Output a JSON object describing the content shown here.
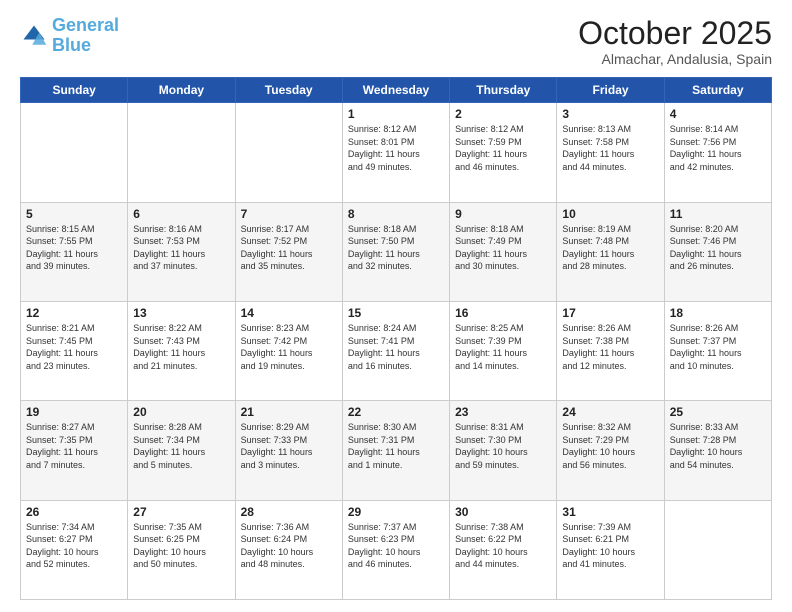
{
  "header": {
    "logo_line1": "General",
    "logo_line2": "Blue",
    "month_title": "October 2025",
    "location": "Almachar, Andalusia, Spain"
  },
  "weekdays": [
    "Sunday",
    "Monday",
    "Tuesday",
    "Wednesday",
    "Thursday",
    "Friday",
    "Saturday"
  ],
  "weeks": [
    [
      {
        "day": "",
        "info": ""
      },
      {
        "day": "",
        "info": ""
      },
      {
        "day": "",
        "info": ""
      },
      {
        "day": "1",
        "info": "Sunrise: 8:12 AM\nSunset: 8:01 PM\nDaylight: 11 hours\nand 49 minutes."
      },
      {
        "day": "2",
        "info": "Sunrise: 8:12 AM\nSunset: 7:59 PM\nDaylight: 11 hours\nand 46 minutes."
      },
      {
        "day": "3",
        "info": "Sunrise: 8:13 AM\nSunset: 7:58 PM\nDaylight: 11 hours\nand 44 minutes."
      },
      {
        "day": "4",
        "info": "Sunrise: 8:14 AM\nSunset: 7:56 PM\nDaylight: 11 hours\nand 42 minutes."
      }
    ],
    [
      {
        "day": "5",
        "info": "Sunrise: 8:15 AM\nSunset: 7:55 PM\nDaylight: 11 hours\nand 39 minutes."
      },
      {
        "day": "6",
        "info": "Sunrise: 8:16 AM\nSunset: 7:53 PM\nDaylight: 11 hours\nand 37 minutes."
      },
      {
        "day": "7",
        "info": "Sunrise: 8:17 AM\nSunset: 7:52 PM\nDaylight: 11 hours\nand 35 minutes."
      },
      {
        "day": "8",
        "info": "Sunrise: 8:18 AM\nSunset: 7:50 PM\nDaylight: 11 hours\nand 32 minutes."
      },
      {
        "day": "9",
        "info": "Sunrise: 8:18 AM\nSunset: 7:49 PM\nDaylight: 11 hours\nand 30 minutes."
      },
      {
        "day": "10",
        "info": "Sunrise: 8:19 AM\nSunset: 7:48 PM\nDaylight: 11 hours\nand 28 minutes."
      },
      {
        "day": "11",
        "info": "Sunrise: 8:20 AM\nSunset: 7:46 PM\nDaylight: 11 hours\nand 26 minutes."
      }
    ],
    [
      {
        "day": "12",
        "info": "Sunrise: 8:21 AM\nSunset: 7:45 PM\nDaylight: 11 hours\nand 23 minutes."
      },
      {
        "day": "13",
        "info": "Sunrise: 8:22 AM\nSunset: 7:43 PM\nDaylight: 11 hours\nand 21 minutes."
      },
      {
        "day": "14",
        "info": "Sunrise: 8:23 AM\nSunset: 7:42 PM\nDaylight: 11 hours\nand 19 minutes."
      },
      {
        "day": "15",
        "info": "Sunrise: 8:24 AM\nSunset: 7:41 PM\nDaylight: 11 hours\nand 16 minutes."
      },
      {
        "day": "16",
        "info": "Sunrise: 8:25 AM\nSunset: 7:39 PM\nDaylight: 11 hours\nand 14 minutes."
      },
      {
        "day": "17",
        "info": "Sunrise: 8:26 AM\nSunset: 7:38 PM\nDaylight: 11 hours\nand 12 minutes."
      },
      {
        "day": "18",
        "info": "Sunrise: 8:26 AM\nSunset: 7:37 PM\nDaylight: 11 hours\nand 10 minutes."
      }
    ],
    [
      {
        "day": "19",
        "info": "Sunrise: 8:27 AM\nSunset: 7:35 PM\nDaylight: 11 hours\nand 7 minutes."
      },
      {
        "day": "20",
        "info": "Sunrise: 8:28 AM\nSunset: 7:34 PM\nDaylight: 11 hours\nand 5 minutes."
      },
      {
        "day": "21",
        "info": "Sunrise: 8:29 AM\nSunset: 7:33 PM\nDaylight: 11 hours\nand 3 minutes."
      },
      {
        "day": "22",
        "info": "Sunrise: 8:30 AM\nSunset: 7:31 PM\nDaylight: 11 hours\nand 1 minute."
      },
      {
        "day": "23",
        "info": "Sunrise: 8:31 AM\nSunset: 7:30 PM\nDaylight: 10 hours\nand 59 minutes."
      },
      {
        "day": "24",
        "info": "Sunrise: 8:32 AM\nSunset: 7:29 PM\nDaylight: 10 hours\nand 56 minutes."
      },
      {
        "day": "25",
        "info": "Sunrise: 8:33 AM\nSunset: 7:28 PM\nDaylight: 10 hours\nand 54 minutes."
      }
    ],
    [
      {
        "day": "26",
        "info": "Sunrise: 7:34 AM\nSunset: 6:27 PM\nDaylight: 10 hours\nand 52 minutes."
      },
      {
        "day": "27",
        "info": "Sunrise: 7:35 AM\nSunset: 6:25 PM\nDaylight: 10 hours\nand 50 minutes."
      },
      {
        "day": "28",
        "info": "Sunrise: 7:36 AM\nSunset: 6:24 PM\nDaylight: 10 hours\nand 48 minutes."
      },
      {
        "day": "29",
        "info": "Sunrise: 7:37 AM\nSunset: 6:23 PM\nDaylight: 10 hours\nand 46 minutes."
      },
      {
        "day": "30",
        "info": "Sunrise: 7:38 AM\nSunset: 6:22 PM\nDaylight: 10 hours\nand 44 minutes."
      },
      {
        "day": "31",
        "info": "Sunrise: 7:39 AM\nSunset: 6:21 PM\nDaylight: 10 hours\nand 41 minutes."
      },
      {
        "day": "",
        "info": ""
      }
    ]
  ]
}
